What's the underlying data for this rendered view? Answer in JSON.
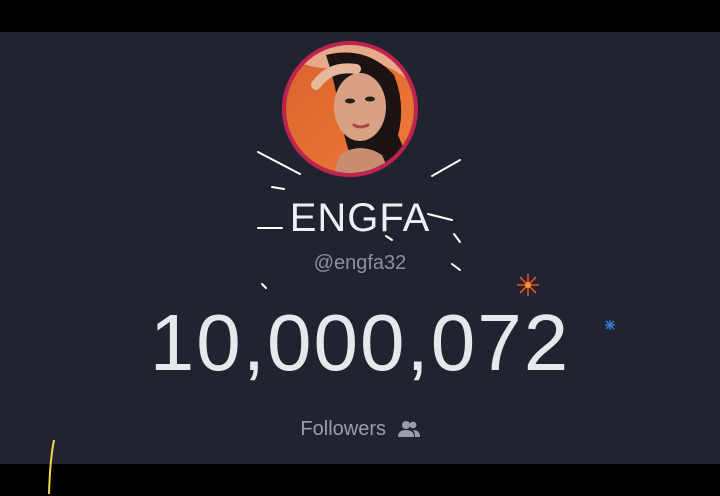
{
  "profile": {
    "display_name": "ENGFA",
    "handle": "@engfa32",
    "avatar_icon": "profile-photo",
    "avatar_ring_color": "#c0234f"
  },
  "stats": {
    "follower_count": "10,000,072",
    "followers_label": "Followers",
    "followers_icon": "people-icon"
  },
  "theme": {
    "background": "#1f2430",
    "text_primary": "#eef0f4",
    "text_secondary": "#8b909b"
  },
  "effects": {
    "firework_colors": [
      "#ffffff",
      "#e8502a",
      "#3b7bd8",
      "#f2d54a"
    ]
  }
}
